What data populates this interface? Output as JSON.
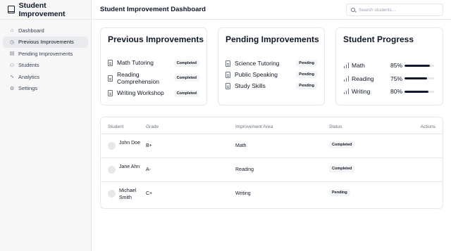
{
  "app": {
    "title": "Student Improvement"
  },
  "sidebar": {
    "items": [
      {
        "label": "Dashboard",
        "icon": "home-icon",
        "active": false
      },
      {
        "label": "Previous Improvements",
        "icon": "history-icon",
        "active": true
      },
      {
        "label": "Pending Improvements",
        "icon": "clipboard-icon",
        "active": false
      },
      {
        "label": "Students",
        "icon": "users-icon",
        "active": false
      },
      {
        "label": "Analytics",
        "icon": "chart-icon",
        "active": false
      },
      {
        "label": "Settings",
        "icon": "gear-icon",
        "active": false
      }
    ]
  },
  "header": {
    "title": "Student Improvement Dashboard",
    "search_placeholder": "Search students..."
  },
  "previous": {
    "title": "Previous Improvements",
    "items": [
      {
        "label": "Math Tutoring",
        "status": "Completed"
      },
      {
        "label": "Reading Comprehension",
        "status": "Completed"
      },
      {
        "label": "Writing Workshop",
        "status": "Completed"
      }
    ]
  },
  "pending": {
    "title": "Pending Improvements",
    "items": [
      {
        "label": "Science Tutoring",
        "status": "Pending"
      },
      {
        "label": "Public Speaking",
        "status": "Pending"
      },
      {
        "label": "Study Skills",
        "status": "Pending"
      }
    ]
  },
  "progress": {
    "title": "Student Progress",
    "items": [
      {
        "label": "Math",
        "value": "85%",
        "fraction": 0.85
      },
      {
        "label": "Reading",
        "value": "75%",
        "fraction": 0.75
      },
      {
        "label": "Writing",
        "value": "80%",
        "fraction": 0.8
      }
    ]
  },
  "table": {
    "headers": {
      "student": "Student",
      "grade": "Grade",
      "area": "Improvement Area",
      "status": "Status",
      "actions": "Actions"
    },
    "rows": [
      {
        "student": "John Doe",
        "grade": "B+",
        "area": "Math",
        "status": "Completed"
      },
      {
        "student": "Jane Ahn",
        "grade": "A-",
        "area": "Reading",
        "status": "Completed"
      },
      {
        "student": "Michael Smith",
        "grade": "C+",
        "area": "Writing",
        "status": "Pending"
      }
    ]
  },
  "colors": {
    "accent": "#111827",
    "sidebar_bg": "#f7f7f8",
    "active_item_bg": "#e9eaee",
    "badge_bg": "#f3f4f6",
    "border": "#e5e7eb"
  }
}
